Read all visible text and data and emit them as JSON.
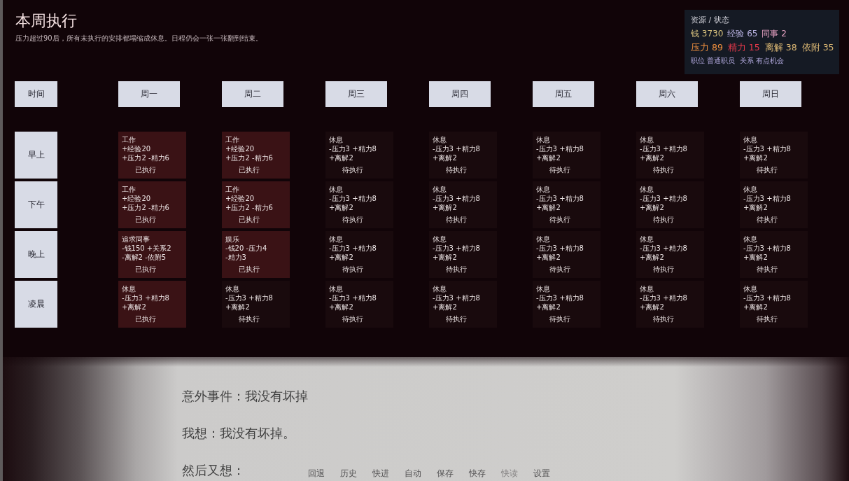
{
  "header": {
    "title": "本周执行",
    "subtitle": "压力超过90后，所有未执行的安排都塌缩成休息。日程仍会一张一张翻到结束。"
  },
  "status_panel": {
    "title": "资源 / 状态",
    "stat_rows": [
      [
        {
          "text": "钱 3730",
          "color": "#d8c27e"
        },
        {
          "text": "经验 65",
          "color": "#b9b2e2"
        },
        {
          "text": "同事 2",
          "color": "#e6a2c2"
        }
      ],
      [
        {
          "text": "压力 89",
          "color": "#f0903e"
        },
        {
          "text": "精力 15",
          "color": "#e8394b"
        },
        {
          "text": "离解 38",
          "color": "#dcb874"
        },
        {
          "text": "依附 35",
          "color": "#dcb874"
        }
      ]
    ],
    "info": [
      "职位 普通职员",
      "关系 有点机会"
    ]
  },
  "schedule": {
    "corner": "时间",
    "days": [
      "周一",
      "周二",
      "周三",
      "周四",
      "周五",
      "周六",
      "周日"
    ],
    "rows": [
      {
        "label": "早上",
        "cells": [
          {
            "lines": [
              "工作",
              "+经验20",
              "+压力2 -精力6"
            ],
            "status": "已执行",
            "executed": true
          },
          {
            "lines": [
              "工作",
              "+经验20",
              "+压力2 -精力6"
            ],
            "status": "已执行",
            "executed": true
          },
          {
            "lines": [
              "休息",
              "-压力3 +精力8",
              "+离解2"
            ],
            "status": "待执行",
            "executed": false
          },
          {
            "lines": [
              "休息",
              "-压力3 +精力8",
              "+离解2"
            ],
            "status": "待执行",
            "executed": false
          },
          {
            "lines": [
              "休息",
              "-压力3 +精力8",
              "+离解2"
            ],
            "status": "待执行",
            "executed": false
          },
          {
            "lines": [
              "休息",
              "-压力3 +精力8",
              "+离解2"
            ],
            "status": "待执行",
            "executed": false
          },
          {
            "lines": [
              "休息",
              "-压力3 +精力8",
              "+离解2"
            ],
            "status": "待执行",
            "executed": false
          }
        ]
      },
      {
        "label": "下午",
        "cells": [
          {
            "lines": [
              "工作",
              "+经验20",
              "+压力2 -精力6"
            ],
            "status": "已执行",
            "executed": true
          },
          {
            "lines": [
              "工作",
              "+经验20",
              "+压力2 -精力6"
            ],
            "status": "已执行",
            "executed": true
          },
          {
            "lines": [
              "休息",
              "-压力3 +精力8",
              "+离解2"
            ],
            "status": "待执行",
            "executed": false
          },
          {
            "lines": [
              "休息",
              "-压力3 +精力8",
              "+离解2"
            ],
            "status": "待执行",
            "executed": false
          },
          {
            "lines": [
              "休息",
              "-压力3 +精力8",
              "+离解2"
            ],
            "status": "待执行",
            "executed": false
          },
          {
            "lines": [
              "休息",
              "-压力3 +精力8",
              "+离解2"
            ],
            "status": "待执行",
            "executed": false
          },
          {
            "lines": [
              "休息",
              "-压力3 +精力8",
              "+离解2"
            ],
            "status": "待执行",
            "executed": false
          }
        ]
      },
      {
        "label": "晚上",
        "cells": [
          {
            "lines": [
              "追求同事",
              "-钱150 +关系2",
              "-离解2 -依附5"
            ],
            "status": "已执行",
            "executed": true
          },
          {
            "lines": [
              "娱乐",
              "-钱20 -压力4",
              "-精力3"
            ],
            "status": "已执行",
            "executed": true
          },
          {
            "lines": [
              "休息",
              "-压力3 +精力8",
              "+离解2"
            ],
            "status": "待执行",
            "executed": false
          },
          {
            "lines": [
              "休息",
              "-压力3 +精力8",
              "+离解2"
            ],
            "status": "待执行",
            "executed": false
          },
          {
            "lines": [
              "休息",
              "-压力3 +精力8",
              "+离解2"
            ],
            "status": "待执行",
            "executed": false
          },
          {
            "lines": [
              "休息",
              "-压力3 +精力8",
              "+离解2"
            ],
            "status": "待执行",
            "executed": false
          },
          {
            "lines": [
              "休息",
              "-压力3 +精力8",
              "+离解2"
            ],
            "status": "待执行",
            "executed": false
          }
        ]
      },
      {
        "label": "凌晨",
        "cells": [
          {
            "lines": [
              "休息",
              "-压力3 +精力8",
              "+离解2"
            ],
            "status": "已执行",
            "executed": true
          },
          {
            "lines": [
              "休息",
              "-压力3 +精力8",
              "+离解2"
            ],
            "status": "待执行",
            "executed": false
          },
          {
            "lines": [
              "休息",
              "-压力3 +精力8",
              "+离解2"
            ],
            "status": "待执行",
            "executed": false
          },
          {
            "lines": [
              "休息",
              "-压力3 +精力8",
              "+离解2"
            ],
            "status": "待执行",
            "executed": false
          },
          {
            "lines": [
              "休息",
              "-压力3 +精力8",
              "+离解2"
            ],
            "status": "待执行",
            "executed": false
          },
          {
            "lines": [
              "休息",
              "-压力3 +精力8",
              "+离解2"
            ],
            "status": "待执行",
            "executed": false
          },
          {
            "lines": [
              "休息",
              "-压力3 +精力8",
              "+离解2"
            ],
            "status": "待执行",
            "executed": false
          }
        ]
      }
    ]
  },
  "dialogue": [
    "意外事件：我没有坏掉",
    "我想：我没有坏掉。",
    "然后又想："
  ],
  "quick_menu": [
    {
      "label": "回退",
      "disabled": false
    },
    {
      "label": "历史",
      "disabled": false
    },
    {
      "label": "快进",
      "disabled": false
    },
    {
      "label": "自动",
      "disabled": false
    },
    {
      "label": "保存",
      "disabled": false
    },
    {
      "label": "快存",
      "disabled": false
    },
    {
      "label": "快读",
      "disabled": true
    },
    {
      "label": "设置",
      "disabled": false
    }
  ]
}
